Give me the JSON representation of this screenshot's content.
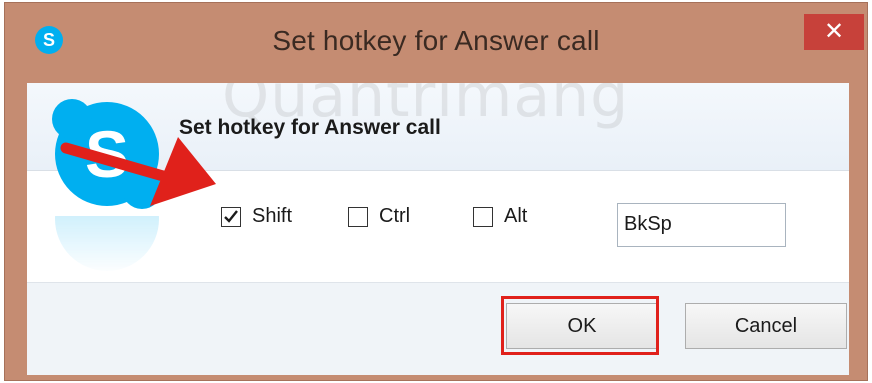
{
  "window": {
    "title": "Set hotkey for Answer call",
    "close_glyph": "✕",
    "app_icon_letter": "S",
    "app_icon": "skype-icon"
  },
  "watermark": {
    "text": "Quantrimang"
  },
  "dialog": {
    "heading": "Set hotkey for Answer call",
    "logo_letter": "S"
  },
  "modifiers": [
    {
      "label": "Shift",
      "checked": true
    },
    {
      "label": "Ctrl",
      "checked": false
    },
    {
      "label": "Alt",
      "checked": false
    }
  ],
  "key_field": {
    "value": "BkSp"
  },
  "buttons": {
    "ok_label": "OK",
    "cancel_label": "Cancel"
  },
  "colors": {
    "skype_blue": "#00aff0",
    "annotation_red": "#e0211b",
    "frame": "#c58c72"
  }
}
